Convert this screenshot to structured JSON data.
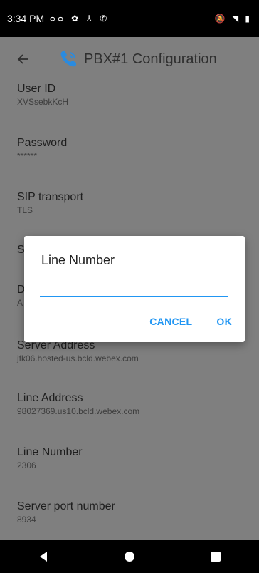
{
  "status_bar": {
    "time": "3:34 PM"
  },
  "app_bar": {
    "title": "PBX#1 Configuration"
  },
  "settings": [
    {
      "label": "User ID",
      "value": "XVSsebkKcH"
    },
    {
      "label": "Password",
      "value": "******"
    },
    {
      "label": "SIP transport",
      "value": "TLS"
    },
    {
      "label": "S",
      "value": ""
    },
    {
      "label": "D",
      "value": "A"
    },
    {
      "label": "Server Address",
      "value": "jfk06.hosted-us.bcld.webex.com"
    },
    {
      "label": "Line Address",
      "value": "98027369.us10.bcld.webex.com"
    },
    {
      "label": "Line Number",
      "value": "2306"
    },
    {
      "label": "Server port number",
      "value": "8934"
    }
  ],
  "dialog": {
    "title": "Line Number",
    "input_value": "",
    "cancel_label": "CANCEL",
    "ok_label": "OK"
  },
  "colors": {
    "accent": "#2196f3",
    "phone_icon": "#2a8be0"
  }
}
